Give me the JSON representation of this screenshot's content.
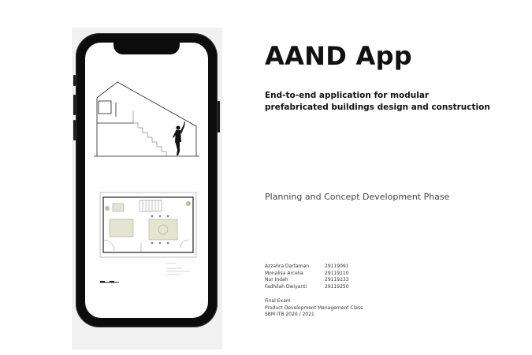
{
  "title": "AAND App",
  "subtitle": {
    "line1": "End-to-end application for modular",
    "line2": "prefabricated buildings design and construction"
  },
  "phase": "Planning and Concept Development Phase",
  "members": [
    {
      "name": "Azzahra Dartaman",
      "nim": "29119091"
    },
    {
      "name": "Monalisa Arcelia",
      "nim": "29119110"
    },
    {
      "name": "Nur Indah",
      "nim": "29119233"
    },
    {
      "name": "Fadhilah Dwiyanti",
      "nim": "29119250"
    }
  ],
  "course": {
    "line1": "Final Exam",
    "line2": "Product Development Management Class",
    "line3": "SBM ITB 2020 / 2021"
  },
  "colors": {
    "panel": "#f1f1f1",
    "phone_body": "#0c0c0c",
    "furniture": "#e3e5d0"
  }
}
